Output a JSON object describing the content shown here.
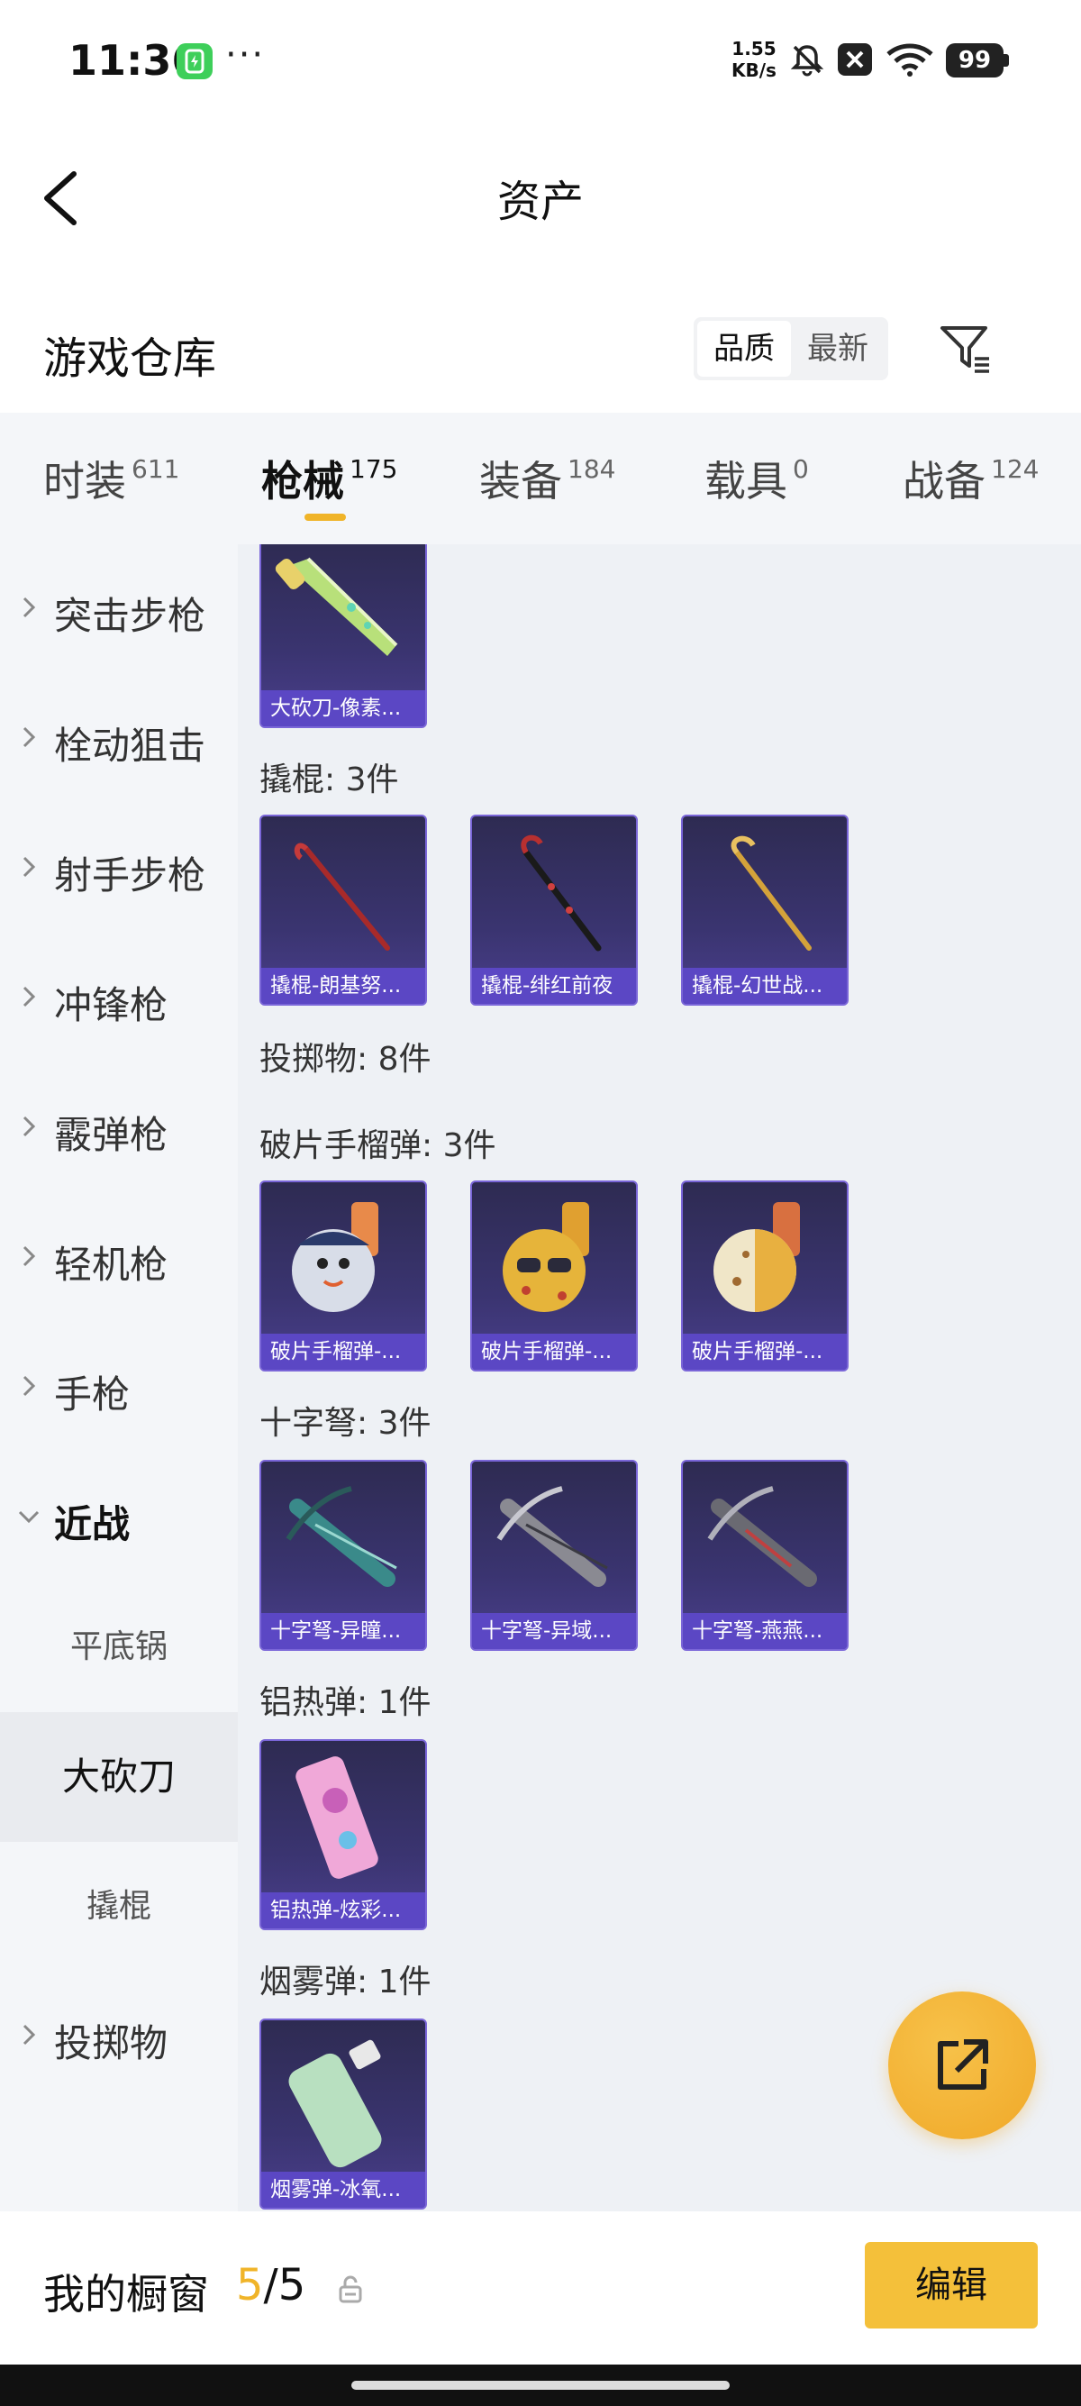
{
  "status_bar": {
    "time": "11:36",
    "dots": "···",
    "speed_value": "1.55",
    "speed_unit": "KB/s",
    "battery": "99"
  },
  "header": {
    "title": "资产"
  },
  "section": {
    "title": "游戏仓库",
    "sort_options": [
      "品质",
      "最新"
    ],
    "sort_selected": "品质"
  },
  "tabs": [
    {
      "label": "时装",
      "count": "611"
    },
    {
      "label": "枪械",
      "count": "175",
      "active": true
    },
    {
      "label": "装备",
      "count": "184"
    },
    {
      "label": "载具",
      "count": "0"
    },
    {
      "label": "战备",
      "count": "124"
    }
  ],
  "sidebar": {
    "items": [
      {
        "label": "突击步枪"
      },
      {
        "label": "栓动狙击"
      },
      {
        "label": "射手步枪"
      },
      {
        "label": "冲锋枪"
      },
      {
        "label": "霰弹枪"
      },
      {
        "label": "轻机枪"
      },
      {
        "label": "手枪"
      },
      {
        "label": "近战",
        "expanded": true
      },
      {
        "label": "投掷物"
      }
    ],
    "sub_items": [
      {
        "label": "平底锅"
      },
      {
        "label": "大砍刀",
        "active": true
      },
      {
        "label": "撬棍"
      }
    ]
  },
  "content": {
    "groups": [
      {
        "label": "",
        "items": [
          "大砍刀-像素..."
        ]
      },
      {
        "label": "撬棍: 3件",
        "items": [
          "撬棍-朗基努...",
          "撬棍-绯红前夜",
          "撬棍-幻世战..."
        ]
      },
      {
        "label": "投掷物: 8件",
        "items": []
      },
      {
        "label": "破片手榴弹: 3件",
        "items": [
          "破片手榴弹-...",
          "破片手榴弹-...",
          "破片手榴弹-..."
        ]
      },
      {
        "label": "十字弩: 3件",
        "items": [
          "十字弩-异瞳...",
          "十字弩-异域...",
          "十字弩-燕燕..."
        ]
      },
      {
        "label": "铝热弹: 1件",
        "items": [
          "铝热弹-炫彩..."
        ]
      },
      {
        "label": "烟雾弹: 1件",
        "items": [
          "烟雾弹-冰氧..."
        ]
      }
    ]
  },
  "bottom_bar": {
    "label": "我的橱窗",
    "current": "5",
    "total": "/5",
    "edit_label": "编辑"
  },
  "colors": {
    "accent": "#f0b429",
    "card_bg": "#3a3470",
    "card_label": "#5b47c4"
  }
}
